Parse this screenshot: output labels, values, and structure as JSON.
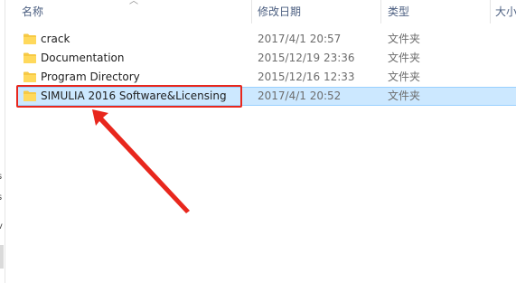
{
  "header": {
    "col_name": "名称",
    "col_date": "修改日期",
    "col_type": "类型",
    "col_size": "大小"
  },
  "nav_fragments": [
    "ı",
    "ı",
    "s",
    "s",
    "v"
  ],
  "rows": [
    {
      "name": "crack",
      "date": "2017/4/1 20:57",
      "type": "文件夹",
      "selected": false
    },
    {
      "name": "Documentation",
      "date": "2015/12/19 23:36",
      "type": "文件夹",
      "selected": false
    },
    {
      "name": "Program Directory",
      "date": "2015/12/16 12:33",
      "type": "文件夹",
      "selected": false
    },
    {
      "name": "SIMULIA 2016 Software&Licensing",
      "date": "2017/4/1 20:52",
      "type": "文件夹",
      "selected": true
    }
  ],
  "annotation": {
    "box_color": "#e8271d",
    "arrow_color": "#e8271d"
  },
  "colors": {
    "selection_bg": "#cce8ff",
    "selection_border": "#99d1ff",
    "folder": "#f6c945"
  }
}
